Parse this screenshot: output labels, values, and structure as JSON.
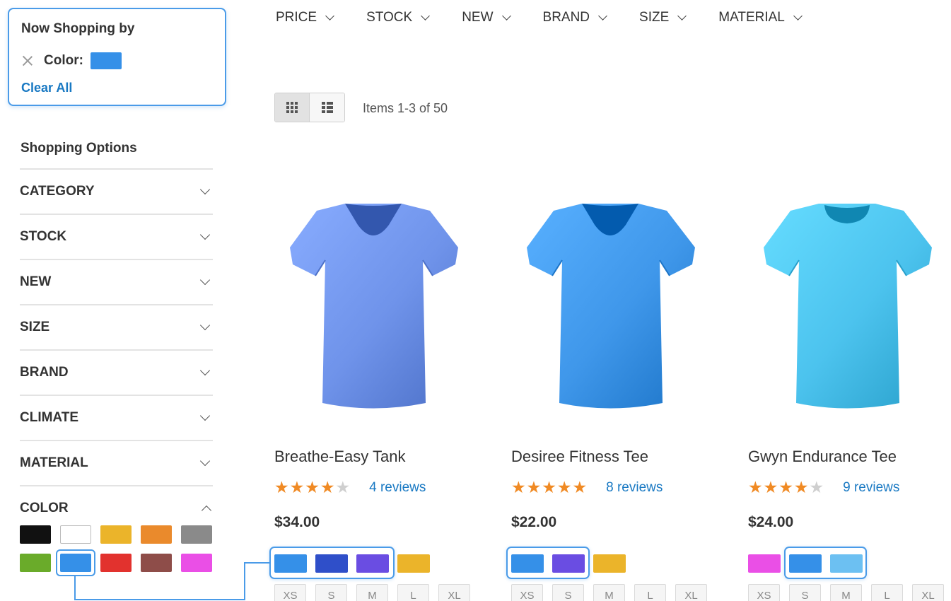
{
  "now_shopping": {
    "title": "Now Shopping by",
    "filter_label": "Color:",
    "filter_color": "#3590e8",
    "clear_all": "Clear All"
  },
  "sidebar": {
    "title": "Shopping Options",
    "options": [
      {
        "label": "CATEGORY"
      },
      {
        "label": "STOCK"
      },
      {
        "label": "NEW"
      },
      {
        "label": "SIZE"
      },
      {
        "label": "BRAND"
      },
      {
        "label": "CLIMATE"
      },
      {
        "label": "MATERIAL"
      }
    ],
    "color_label": "COLOR",
    "color_swatches": [
      "#111111",
      "#ffffff",
      "#ebb42a",
      "#ea8a2c",
      "#8a8a8a",
      "#6aab2a",
      "#3590e8",
      "#e2322e",
      "#8e4d49",
      "#ea4fe6"
    ],
    "selected_color_index": 6
  },
  "top_filters": [
    "PRICE",
    "STOCK",
    "NEW",
    "BRAND",
    "SIZE",
    "MATERIAL"
  ],
  "toolbar": {
    "items_count": "Items 1-3 of 50"
  },
  "products": [
    {
      "name": "Breathe-Easy Tank",
      "rating": 4,
      "reviews": "4 reviews",
      "price": "$34.00",
      "shirt_color": "#6f93ea",
      "swatches": [
        "#3590e8",
        "#2f4fc9",
        "#6a4de2",
        "#ebb42a"
      ],
      "sizes": [
        "XS",
        "S",
        "M",
        "L",
        "XL"
      ]
    },
    {
      "name": "Desiree Fitness Tee",
      "rating": 5,
      "reviews": "8 reviews",
      "price": "$22.00",
      "shirt_color": "#3f97ea",
      "swatches": [
        "#3590e8",
        "#6a4de2",
        "#ebb42a"
      ],
      "sizes": [
        "XS",
        "S",
        "M",
        "L",
        "XL"
      ]
    },
    {
      "name": "Gwyn Endurance Tee",
      "rating": 4,
      "reviews": "9 reviews",
      "price": "$24.00",
      "shirt_color": "#4cc3ee",
      "swatches": [
        "#ea4fe6",
        "#3590e8",
        "#6cc0f2"
      ],
      "sizes": [
        "XS",
        "S",
        "M",
        "L",
        "XL"
      ]
    }
  ],
  "colors": {
    "accent": "#4a9be8",
    "link": "#1979c3",
    "star": "#f08a24"
  }
}
